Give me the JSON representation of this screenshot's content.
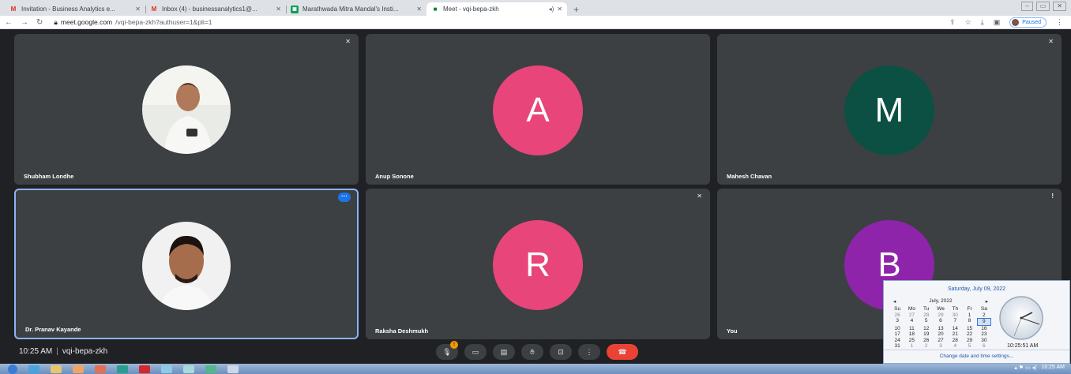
{
  "browser": {
    "tabs": [
      {
        "label": "Invitation - Business Analytics e...",
        "icon": "gmail-icon",
        "active": false
      },
      {
        "label": "Inbox (4) - businessanalytics1@...",
        "icon": "gmail-icon",
        "active": false
      },
      {
        "label": "Marathwada Mitra Mandal's Insti...",
        "icon": "classroom-icon",
        "active": false
      },
      {
        "label": "Meet - vqi-bepa-zkh",
        "icon": "meet-icon",
        "active": true
      }
    ],
    "url_host": "meet.google.com",
    "url_path": "/vqi-bepa-zkh?authuser=1&pli=1",
    "profile_status": "Paused"
  },
  "participants": [
    {
      "name": "Shubham Londhe",
      "kind": "photo"
    },
    {
      "name": "Anup Sonone",
      "kind": "letter",
      "initial": "A",
      "color": "#e8457a"
    },
    {
      "name": "Mahesh Chavan",
      "kind": "letter",
      "initial": "M",
      "color": "#0b5043"
    },
    {
      "name": "Dr. Pranav Kayande",
      "kind": "photo"
    },
    {
      "name": "Raksha Deshmukh",
      "kind": "letter",
      "initial": "R",
      "color": "#e8457a"
    },
    {
      "name": "You",
      "kind": "letter",
      "initial": "B",
      "color": "#8e24aa"
    }
  ],
  "meeting": {
    "time": "10:25 AM",
    "code": "vqi-bepa-zkh",
    "mic_badge": "!"
  },
  "clock_popup": {
    "date": "Saturday, July 09, 2022",
    "month": "July, 2022",
    "weekdays": [
      "Su",
      "Mo",
      "Tu",
      "We",
      "Th",
      "Fr",
      "Sa"
    ],
    "days": [
      "26",
      "27",
      "28",
      "29",
      "30",
      "1",
      "2",
      "3",
      "4",
      "5",
      "6",
      "7",
      "8",
      "9",
      "10",
      "11",
      "12",
      "13",
      "14",
      "15",
      "16",
      "17",
      "18",
      "19",
      "20",
      "21",
      "22",
      "23",
      "24",
      "25",
      "26",
      "27",
      "28",
      "29",
      "30",
      "31",
      "1",
      "2",
      "3",
      "4",
      "5",
      "6"
    ],
    "time": "10:25:51 AM",
    "link": "Change date and time settings..."
  },
  "taskbar": {
    "clock": "10:25 AM"
  }
}
